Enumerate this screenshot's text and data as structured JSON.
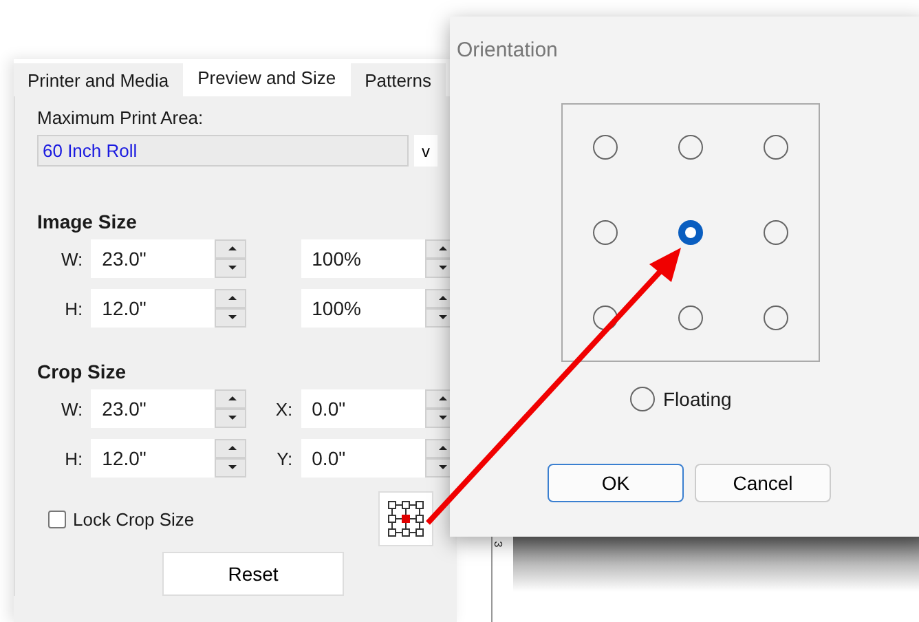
{
  "tabs": [
    {
      "label": "Printer and Media",
      "selected": false
    },
    {
      "label": "Preview and Size",
      "selected": true
    },
    {
      "label": "Patterns",
      "selected": false
    }
  ],
  "print_area": {
    "label": "Maximum Print Area:",
    "value": "60 Inch Roll",
    "button": "v"
  },
  "image_size": {
    "title": "Image Size",
    "rows": [
      {
        "label": "W:",
        "value": "23.0\"",
        "value_2": "100%"
      },
      {
        "label": "H:",
        "value": "12.0\"",
        "value_2": "100%"
      }
    ]
  },
  "crop_size": {
    "title": "Crop Size",
    "rows": [
      {
        "label": "W:",
        "value": "23.0\"",
        "label_2": "X:",
        "value_2": "0.0\""
      },
      {
        "label": "H:",
        "value": "12.0\"",
        "label_2": "Y:",
        "value_2": "0.0\""
      }
    ]
  },
  "lock_crop": {
    "label": "Lock Crop Size",
    "checked": false
  },
  "reset_button": "Reset",
  "ruler": {
    "label": "3"
  },
  "dialog": {
    "title": "Orientation",
    "positions": [
      {
        "selected": false
      },
      {
        "selected": false
      },
      {
        "selected": false
      },
      {
        "selected": false
      },
      {
        "selected": true
      },
      {
        "selected": false
      },
      {
        "selected": false
      },
      {
        "selected": false
      },
      {
        "selected": false
      }
    ],
    "floating": {
      "label": "Floating",
      "selected": false
    },
    "buttons": [
      {
        "label": "OK",
        "default": true
      },
      {
        "label": "Cancel",
        "default": false
      }
    ]
  }
}
